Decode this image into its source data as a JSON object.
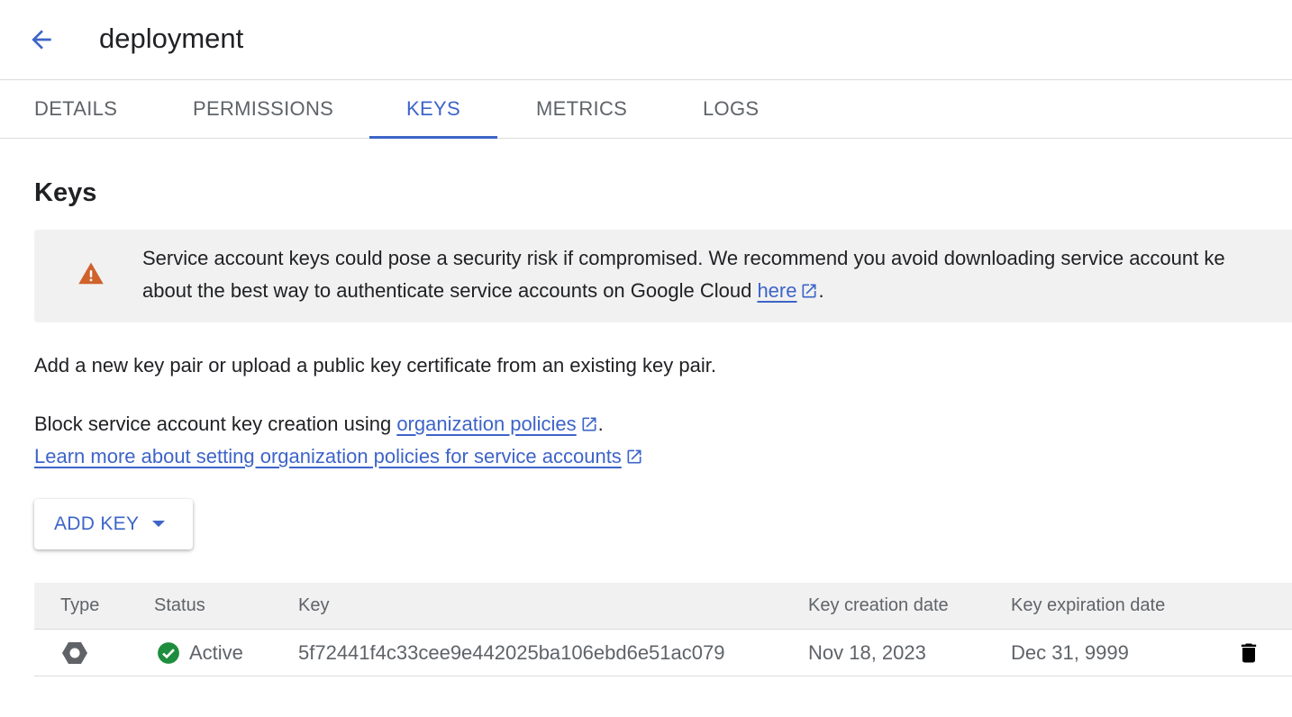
{
  "header": {
    "title": "deployment"
  },
  "tabs": [
    {
      "label": "DETAILS"
    },
    {
      "label": "PERMISSIONS"
    },
    {
      "label": "KEYS",
      "active": true
    },
    {
      "label": "METRICS"
    },
    {
      "label": "LOGS"
    }
  ],
  "section": {
    "title": "Keys"
  },
  "warning": {
    "line1": "Service account keys could pose a security risk if compromised. We recommend you avoid downloading service account ke",
    "line2_prefix": "about the best way to authenticate service accounts on Google Cloud ",
    "link": "here",
    "line2_suffix": "."
  },
  "intro": "Add a new key pair or upload a public key certificate from an existing key pair.",
  "policy": {
    "prefix": "Block service account key creation using ",
    "link": "organization policies",
    "suffix": ".",
    "learn_more": "Learn more about setting organization policies for service accounts"
  },
  "add_key_button": {
    "label": "ADD KEY"
  },
  "table": {
    "columns": [
      "Type",
      "Status",
      "Key",
      "Key creation date",
      "Key expiration date"
    ],
    "rows": [
      {
        "type_icon": "key-type-icon",
        "status": "Active",
        "key": "5f72441f4c33cee9e442025ba106ebd6e51ac079",
        "created": "Nov 18, 2023",
        "expires": "Dec 31, 9999"
      }
    ]
  },
  "colors": {
    "accent": "#3d64c8",
    "warning": "#d0622c",
    "success": "#1e8e3e",
    "text_secondary": "#5f6368"
  }
}
